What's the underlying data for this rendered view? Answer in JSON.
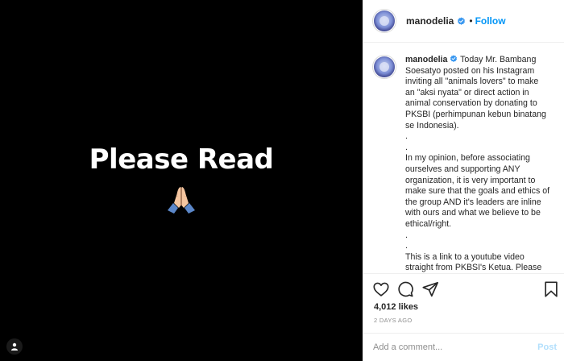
{
  "post": {
    "media_text": "Please Read",
    "media_emoji": "folded-hands"
  },
  "header": {
    "username": "manodelia",
    "separator": "•",
    "follow_label": "Follow"
  },
  "caption": {
    "username": "manodelia",
    "text": "Today Mr. Bambang Soesatyo posted on his Instagram inviting all \"animals lovers\" to make an \"aksi nyata\" or direct action in animal conservation by donating to PKSBI (perhimpunan kebun binatang se Indonesia).\n.\n.\nIn my opinion, before associating ourselves and supporting ANY organization, it is very important to make sure that the goals and ethics of the group AND it's leaders are inline with ours and what we believe to be ethical/right.\n.\n.\nThis is a link to a youtube video straight from PKBSI's Ketua. Please"
  },
  "stats": {
    "likes": "4,012 likes",
    "timestamp": "2 DAYS AGO"
  },
  "comment": {
    "placeholder": "Add a comment...",
    "post_label": "Post"
  },
  "colors": {
    "media_bg": "#000000",
    "accent_blue": "#0095f6",
    "post_disabled": "#b2dffc",
    "verified_blue": "#3897f0",
    "muted": "#8e8e8e"
  },
  "icons": [
    "heart-icon",
    "comment-icon",
    "share-icon",
    "bookmark-icon",
    "verified-badge-icon",
    "user-tag-icon",
    "folded-hands-emoji"
  ]
}
